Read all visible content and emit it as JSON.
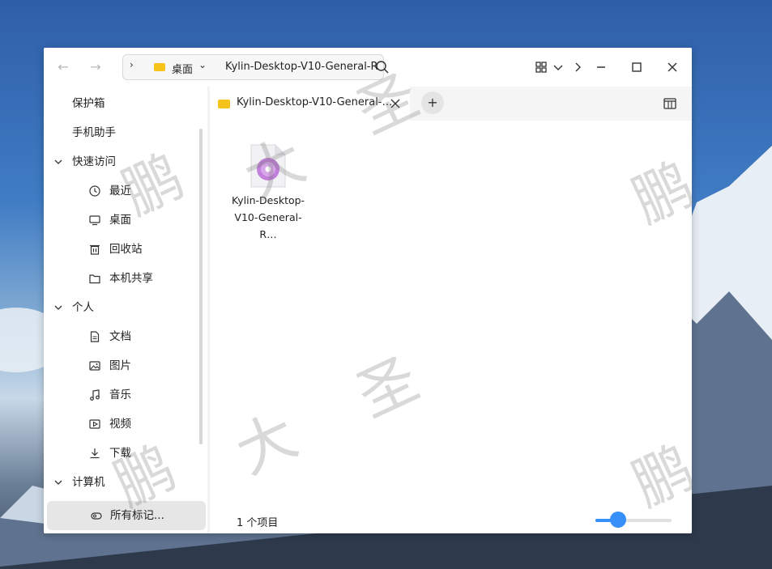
{
  "window": {
    "back_icon": "arrow-left-icon",
    "forward_icon": "arrow-right-icon",
    "path": {
      "location": "桌面",
      "crumb": "Kylin-Desktop-V10-General-R"
    },
    "view_icon": "grid-view-icon",
    "controls": [
      "minimize-icon",
      "maximize-icon",
      "close-icon"
    ]
  },
  "sidebar": {
    "items": [
      {
        "label": "保护箱",
        "kind": "entry"
      },
      {
        "label": "手机助手",
        "kind": "entry"
      },
      {
        "label": "快速访问",
        "kind": "group"
      },
      {
        "label": "最近",
        "kind": "child",
        "icon": "clock-icon"
      },
      {
        "label": "桌面",
        "kind": "child",
        "icon": "monitor-icon"
      },
      {
        "label": "回收站",
        "kind": "child",
        "icon": "trash-icon"
      },
      {
        "label": "本机共享",
        "kind": "child",
        "icon": "folder-icon"
      },
      {
        "label": "个人",
        "kind": "group"
      },
      {
        "label": "文档",
        "kind": "child",
        "icon": "document-icon"
      },
      {
        "label": "图片",
        "kind": "child",
        "icon": "image-icon"
      },
      {
        "label": "音乐",
        "kind": "child",
        "icon": "music-icon"
      },
      {
        "label": "视频",
        "kind": "child",
        "icon": "video-icon"
      },
      {
        "label": "下载",
        "kind": "child",
        "icon": "download-icon"
      },
      {
        "label": "计算机",
        "kind": "group"
      },
      {
        "label": "所有标记...",
        "kind": "child",
        "icon": "tag-icon",
        "selected": true
      }
    ]
  },
  "tabs": [
    {
      "label": "Kylin-Desktop-V10-General-…"
    }
  ],
  "files": [
    {
      "name_line1": "Kylin-Desktop-",
      "name_line2": "V10-General-R…",
      "icon": "disc-image-icon"
    }
  ],
  "status": {
    "count": "1 个项目",
    "zoom": 0.3
  },
  "watermark": [
    "大",
    "圣",
    "鹏"
  ]
}
